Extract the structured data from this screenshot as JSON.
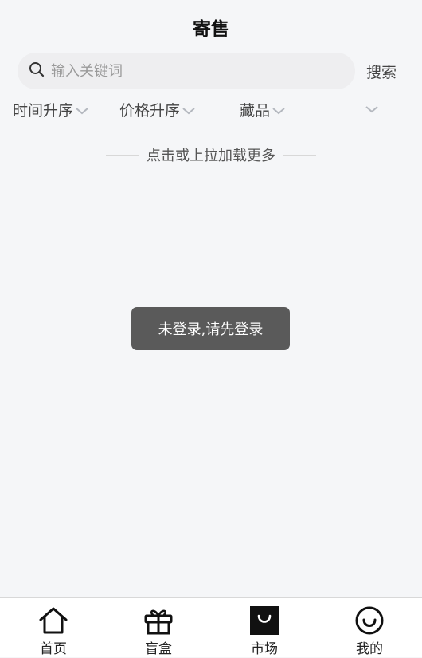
{
  "header": {
    "title": "寄售"
  },
  "search": {
    "placeholder": "输入关键词",
    "value": "",
    "button_label": "搜索"
  },
  "filters": [
    {
      "label": "时间升序"
    },
    {
      "label": "价格升序"
    },
    {
      "label": "藏品"
    },
    {
      "label": ""
    }
  ],
  "list": {
    "load_more_text": "点击或上拉加载更多"
  },
  "toast": {
    "message": "未登录,请先登录"
  },
  "tabbar": {
    "items": [
      {
        "label": "首页",
        "icon": "home-icon",
        "active": false
      },
      {
        "label": "盲盒",
        "icon": "gift-box-icon",
        "active": false
      },
      {
        "label": "市场",
        "icon": "shopping-bag-icon",
        "active": true
      },
      {
        "label": "我的",
        "icon": "smiley-icon",
        "active": false
      }
    ]
  }
}
